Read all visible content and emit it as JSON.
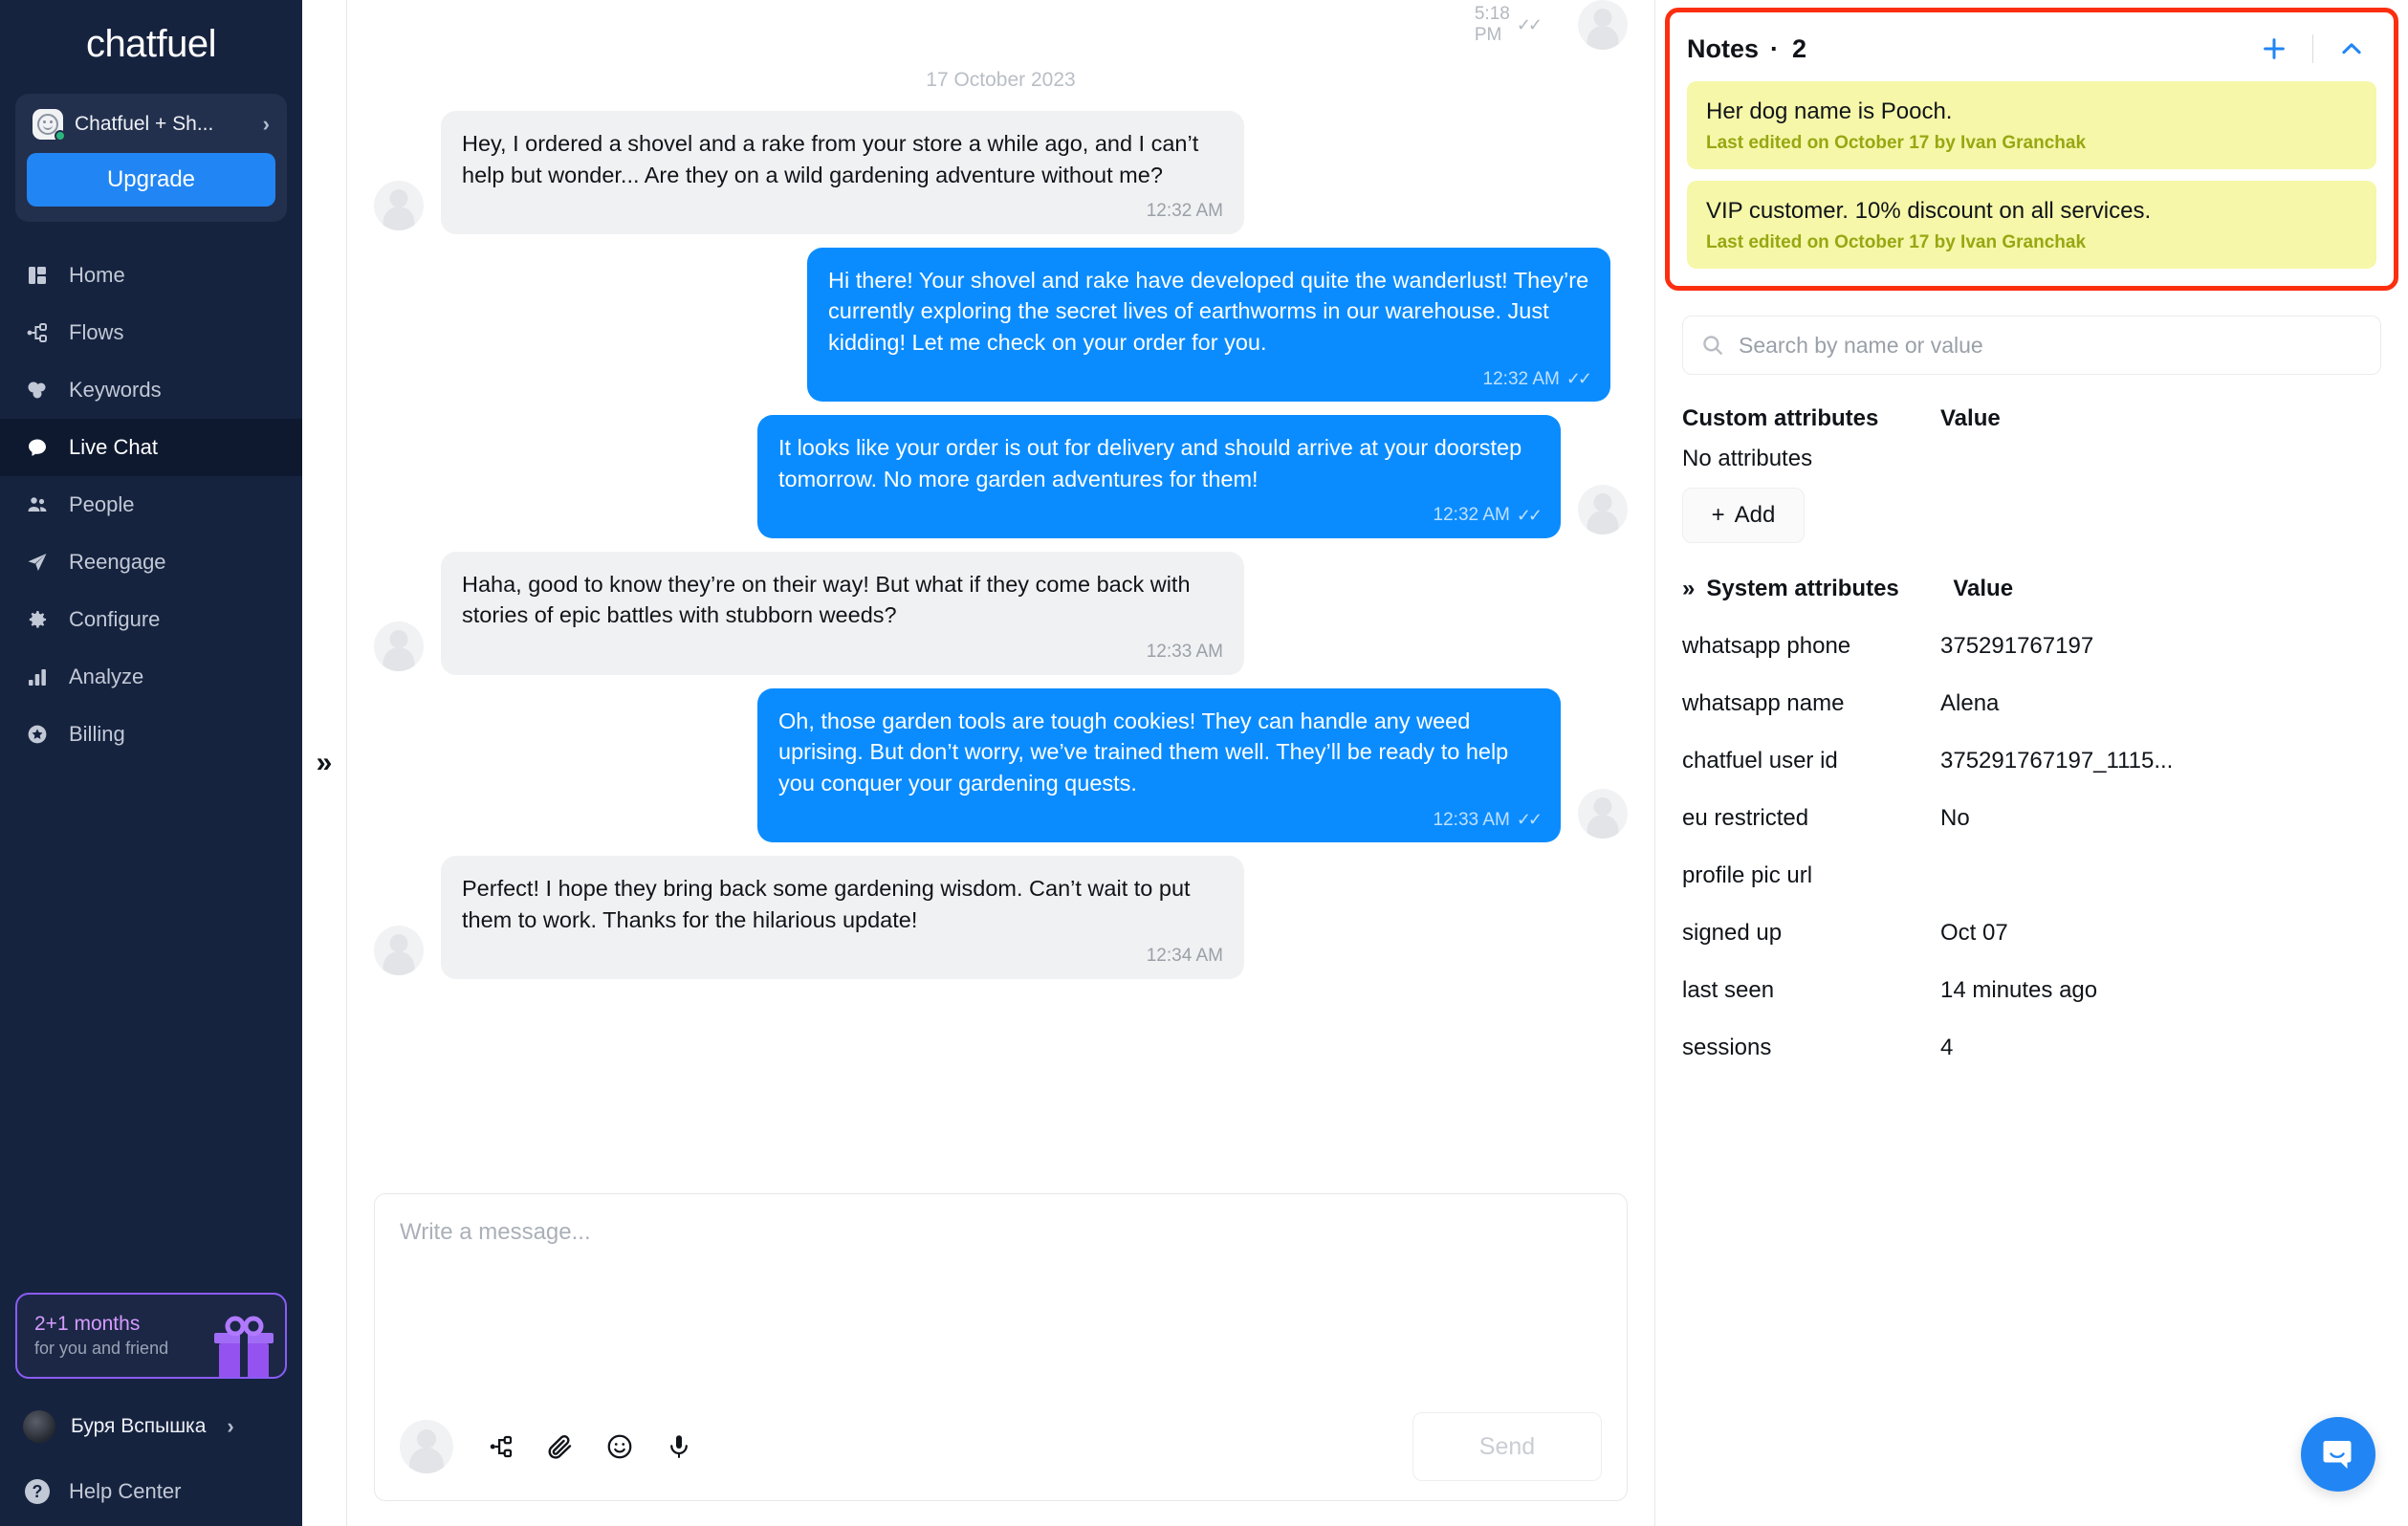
{
  "sidebar": {
    "brand": "chatfuel",
    "account": {
      "name": "Chatfuel + Sh...",
      "chevron": "›"
    },
    "upgrade_label": "Upgrade",
    "nav": [
      {
        "label": "Home",
        "icon": "dashboard-icon",
        "active": false
      },
      {
        "label": "Flows",
        "icon": "flows-icon",
        "active": false
      },
      {
        "label": "Keywords",
        "icon": "keywords-icon",
        "active": false
      },
      {
        "label": "Live Chat",
        "icon": "chat-icon",
        "active": true
      },
      {
        "label": "People",
        "icon": "people-icon",
        "active": false
      },
      {
        "label": "Reengage",
        "icon": "send-icon",
        "active": false
      },
      {
        "label": "Configure",
        "icon": "gear-icon",
        "active": false
      },
      {
        "label": "Analyze",
        "icon": "bar-chart-icon",
        "active": false
      },
      {
        "label": "Billing",
        "icon": "star-badge-icon",
        "active": false
      }
    ],
    "promo": {
      "title": "2+1 months",
      "subtitle": "for you and friend"
    },
    "user": {
      "name": "Буря Вспышка",
      "chevron": "›"
    },
    "help": {
      "label": "Help Center"
    }
  },
  "collapse": {
    "label": "»"
  },
  "chat": {
    "top_clipped_message": {
      "time": "5:18 PM",
      "ticks": "✓✓"
    },
    "day_separator": "17 October 2023",
    "messages": [
      {
        "dir": "in",
        "text": "Hey, I ordered a shovel and a rake from your store a while ago, and I can’t help but wonder... Are they on a wild gardening adventure without me?",
        "time": "12:32 AM",
        "ticks": ""
      },
      {
        "dir": "out",
        "text": "Hi there! Your shovel and rake have developed quite the wanderlust! They’re currently exploring the secret lives of earthworms in our warehouse. Just kidding! Let me check on your order for you.",
        "time": "12:32 AM",
        "ticks": "✓✓"
      },
      {
        "dir": "out",
        "text": "It looks like your order is out for delivery and should arrive at your doorstep tomorrow. No more garden adventures for them!",
        "time": "12:32 AM",
        "ticks": "✓✓"
      },
      {
        "dir": "in",
        "text": "Haha, good to know they’re on their way! But what if they come back with stories of epic battles with stubborn weeds?",
        "time": "12:33 AM",
        "ticks": ""
      },
      {
        "dir": "out",
        "text": "Oh, those garden tools are tough cookies! They can handle any weed uprising. But don’t worry, we’ve trained them well. They’ll be ready to help you conquer your gardening quests.",
        "time": "12:33 AM",
        "ticks": "✓✓"
      },
      {
        "dir": "in",
        "text": "Perfect! I hope they bring back some gardening wisdom. Can’t wait to put them to work. Thanks for the hilarious update!",
        "time": "12:34 AM",
        "ticks": ""
      }
    ],
    "composer": {
      "placeholder": "Write a message...",
      "send_label": "Send",
      "tools": [
        "flow-icon",
        "attachment-icon",
        "emoji-icon",
        "microphone-icon"
      ]
    }
  },
  "right_panel": {
    "notes": {
      "title": "Notes",
      "separator": "·",
      "count": "2",
      "add_icon": "plus-icon",
      "collapse_icon": "chevron-up-icon",
      "items": [
        {
          "text": "Her dog name is Pooch.",
          "meta": "Last edited on October 17 by Ivan Granchak"
        },
        {
          "text": "VIP customer. 10% discount on all services.",
          "meta": "Last edited on October 17 by Ivan Granchak"
        }
      ]
    },
    "search": {
      "placeholder": "Search by name or value",
      "icon": "search-icon"
    },
    "custom_attributes": {
      "header_name": "Custom attributes",
      "header_value": "Value",
      "empty_text": "No attributes",
      "add_label": "Add"
    },
    "system_attributes": {
      "expander": "»",
      "header_name": "System attributes",
      "header_value": "Value",
      "rows": [
        {
          "key": "whatsapp phone",
          "value": "375291767197"
        },
        {
          "key": "whatsapp name",
          "value": "Alena"
        },
        {
          "key": "chatfuel user id",
          "value": "375291767197_1115..."
        },
        {
          "key": "eu restricted",
          "value": "No"
        },
        {
          "key": "profile pic url",
          "value": ""
        },
        {
          "key": "signed up",
          "value": "Oct 07"
        },
        {
          "key": "last seen",
          "value": "14 minutes ago"
        },
        {
          "key": "sessions",
          "value": "4"
        }
      ]
    },
    "intercom": {
      "icon": "intercom-chat-icon"
    }
  },
  "colors": {
    "sidebar_bg": "#16233f",
    "accent_blue": "#2186f4",
    "bubble_out": "#0a8cff",
    "bubble_in": "#f0f1f2",
    "note_yellow": "#f6f7a8",
    "highlight_red": "#fb2f10",
    "promo_purple": "#8b5cf6"
  }
}
